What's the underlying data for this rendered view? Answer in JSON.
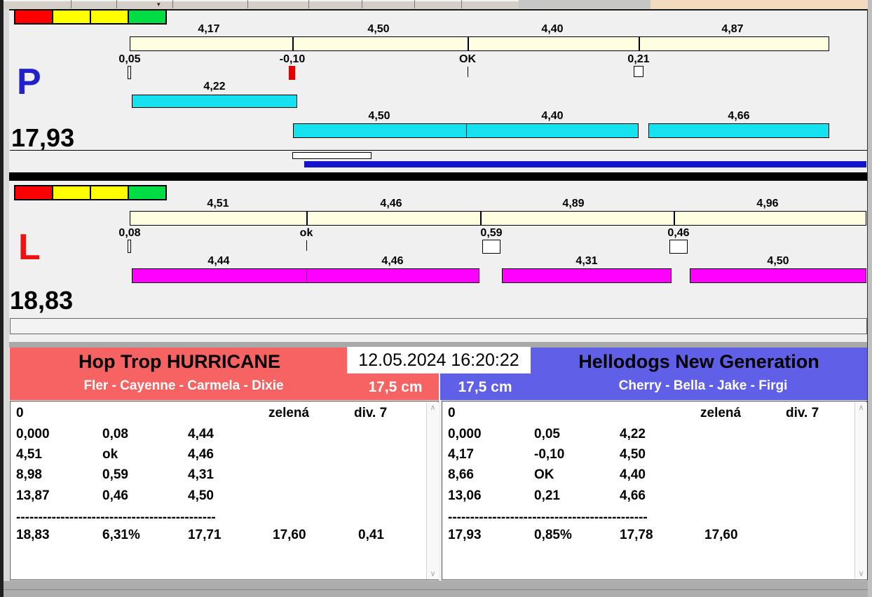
{
  "window": {
    "date_time": "12.05.2024 16:20:22"
  },
  "lane_p": {
    "label": "P",
    "total": "17,93",
    "splits": [
      "4,17",
      "4,50",
      "4,40",
      "4,87"
    ],
    "changes": [
      "0,05",
      "-0,10",
      "OK",
      "0,21"
    ],
    "dog_times": [
      "4,22",
      "4,50",
      "4,40",
      "4,66"
    ]
  },
  "lane_l": {
    "label": "L",
    "total": "18,83",
    "splits": [
      "4,51",
      "4,46",
      "4,89",
      "4,96"
    ],
    "changes": [
      "0,08",
      "ok",
      "0,59",
      "0,46"
    ],
    "dog_times": [
      "4,44",
      "4,46",
      "4,31",
      "4,50"
    ]
  },
  "left_panel": {
    "team": "Hop Trop HURRICANE",
    "dogs": "Fler - Cayenne - Carmela - Dixie",
    "jump_height": "17,5 cm",
    "run_header": {
      "num": "0",
      "color_label": "zelená",
      "division": "div. 7"
    },
    "rows": [
      {
        "c1": "0,000",
        "c2": "0,08",
        "c3": "4,44"
      },
      {
        "c1": "4,51",
        "c2": "ok",
        "c3": "4,46"
      },
      {
        "c1": "8,98",
        "c2": "0,59",
        "c3": "4,31"
      },
      {
        "c1": "13,87",
        "c2": "0,46",
        "c3": "4,50"
      }
    ],
    "divider": "---------------------------------------------",
    "summary": [
      "18,83",
      "6,31%",
      "17,71",
      "17,60",
      "0,41"
    ]
  },
  "right_panel": {
    "team": "Hellodogs New Generation",
    "dogs": "Cherry - Bella - Jake - Firgi",
    "jump_height": "17,5 cm",
    "run_header": {
      "num": "0",
      "color_label": "zelená",
      "division": "div. 7"
    },
    "rows": [
      {
        "c1": "0,000",
        "c2": "0,05",
        "c3": "4,22"
      },
      {
        "c1": "4,17",
        "c2": "-0,10",
        "c3": "4,50"
      },
      {
        "c1": "8,66",
        "c2": "OK",
        "c3": "4,40"
      },
      {
        "c1": "13,06",
        "c2": "0,21",
        "c3": "4,66"
      }
    ],
    "divider": "---------------------------------------------",
    "summary": [
      "17,93",
      "0,85%",
      "17,78",
      "17,60"
    ]
  },
  "colors": {
    "left_team_bg": "#f76262",
    "right_team_bg": "#5f5fe8",
    "lane_p_bar": "#14e2ee",
    "lane_l_bar": "#ff00ff",
    "scale_bar": "#fffee0",
    "progress_bar": "#1414cc",
    "lane_p_letter": "#2222cc",
    "lane_l_letter": "#ee1111",
    "legend": [
      "#ff0000",
      "#ffff00",
      "#ffff00",
      "#00dd44"
    ]
  }
}
